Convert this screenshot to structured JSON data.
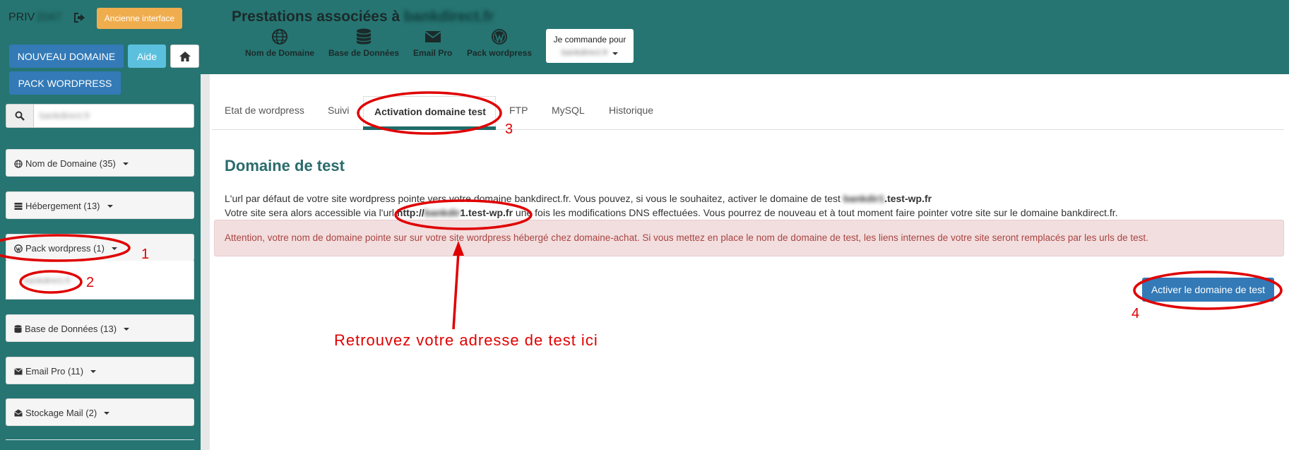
{
  "sidebar": {
    "account": {
      "prefix": "PRIV",
      "masked": "2047"
    },
    "old_interface": "Ancienne interface",
    "new_domain": "NOUVEAU DOMAINE",
    "help": "Aide",
    "pack_wordpress": "PACK WORDPRESS",
    "search": {
      "value": "bankdirect.fr"
    },
    "panels": [
      {
        "label": "Nom de Domaine (35)",
        "icon": "globe-icon"
      },
      {
        "label": "Hébergement (13)",
        "icon": "server-icon"
      },
      {
        "label": "Pack wordpress (1)",
        "icon": "wordpress-icon"
      },
      {
        "label": "Base de Données (13)",
        "icon": "database-icon"
      },
      {
        "label": "Email Pro (11)",
        "icon": "envelope-icon"
      },
      {
        "label": "Stockage Mail (2)",
        "icon": "mail-storage-icon"
      }
    ],
    "pack_item": "bankdirect.fr"
  },
  "header": {
    "title_prefix": "Prestations associées à",
    "title_domain": "bankdirect.fr",
    "services": [
      {
        "label": "Nom de Domaine",
        "icon": "globe-icon"
      },
      {
        "label": "Base de Données",
        "icon": "database-icon"
      },
      {
        "label": "Email Pro",
        "icon": "envelope-icon"
      },
      {
        "label": "Pack wordpress",
        "icon": "wordpress-icon"
      }
    ],
    "commande_label": "Je commande pour",
    "commande_value": "bankdirect.fr"
  },
  "tabs": [
    "Etat de wordpress",
    "Suivi",
    "Activation domaine test",
    "FTP",
    "MySQL",
    "Historique"
  ],
  "content": {
    "title": "Domaine de test",
    "line1_text": "L'url par défaut de votre site wordpress pointe vers votre domaine bankdirect.fr. Vous pouvez, si vous le souhaitez, activer le domaine de test",
    "line1_masked": "bankdir1",
    "line1_suffix": ".test-wp.fr",
    "line2_prefix": "Votre site sera alors accessible via l'url",
    "line2_url_start": "http://",
    "line2_masked": "bankdir",
    "line2_url_end": "1.test-wp.fr",
    "line2_suffix": "une fois les modifications DNS effectuées. Vous pourrez de nouveau et à tout moment faire pointer votre site sur le domaine bankdirect.fr.",
    "alert": "Attention, votre nom de domaine pointe sur sur votre site wordpress hébergé chez domaine-achat. Si vous mettez en place le nom de domaine de test, les liens internes de votre site seront remplacés par les urls de test.",
    "activate_button": "Activer le domaine de test"
  },
  "annotations": {
    "numbers": [
      "1",
      "2",
      "3",
      "4"
    ],
    "text": "Retrouvez votre adresse de test ici",
    "color": "#e00000"
  }
}
